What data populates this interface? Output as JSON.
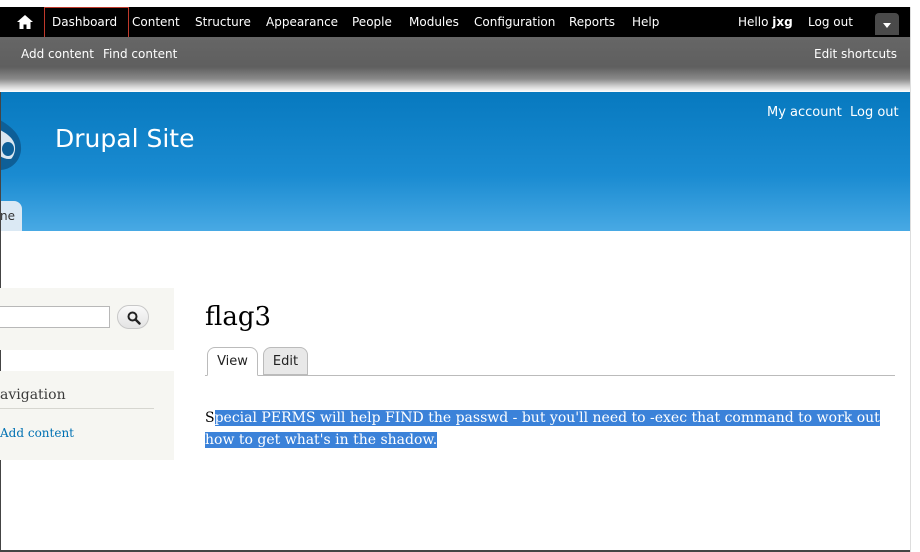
{
  "toolbar": {
    "home_icon": "home-icon",
    "menu": [
      "Dashboard",
      "Content",
      "Structure",
      "Appearance",
      "People",
      "Modules",
      "Configuration",
      "Reports",
      "Help"
    ],
    "hello_prefix": "Hello ",
    "username": "jxg",
    "logout": "Log out",
    "toggle_icon": "caret-down-icon"
  },
  "shortcuts": {
    "add_content": "Add content",
    "find_content": "Find content",
    "edit_shortcuts": "Edit shortcuts"
  },
  "header": {
    "site_name": "Drupal Site",
    "my_account": "My account",
    "logout": "Log out",
    "home_tab_fragment": "ne",
    "colors": {
      "header_top": "#0779bf",
      "header_bottom": "#48a9e4"
    }
  },
  "sidebar": {
    "search_placeholder": "",
    "search_icon": "search-icon",
    "navigation_title_fragment": "avigation",
    "add_content_link": "Add content"
  },
  "main": {
    "title": "flag3",
    "tabs": [
      "View",
      "Edit"
    ],
    "body_first": "S",
    "body_selected": "pecial PERMS will help FIND the passwd - but you'll need to -exec that command to work out how to get what's in the shadow."
  }
}
